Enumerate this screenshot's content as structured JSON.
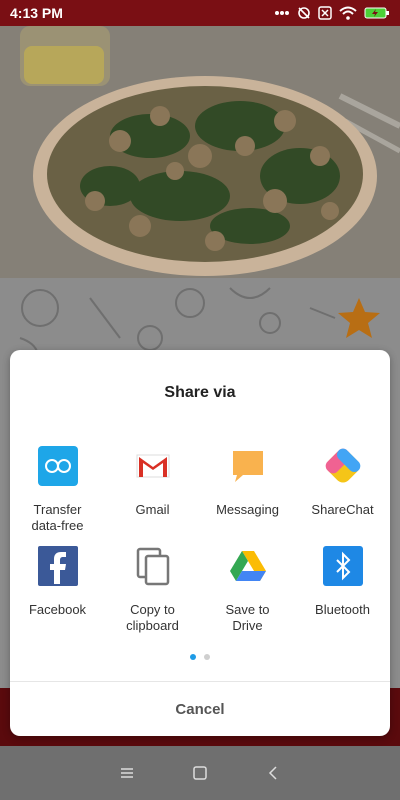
{
  "status": {
    "time": "4:13 PM"
  },
  "sheet": {
    "title": "Share via",
    "cancel": "Cancel",
    "apps": [
      {
        "label": "Transfer\ndata-free",
        "icon": "shareme-icon"
      },
      {
        "label": "Gmail",
        "icon": "gmail-icon"
      },
      {
        "label": "Messaging",
        "icon": "messaging-icon"
      },
      {
        "label": "ShareChat",
        "icon": "sharechat-icon"
      },
      {
        "label": "Facebook",
        "icon": "facebook-icon"
      },
      {
        "label": "Copy to\nclipboard",
        "icon": "copy-icon"
      },
      {
        "label": "Save to\nDrive",
        "icon": "drive-icon"
      },
      {
        "label": "Bluetooth",
        "icon": "bluetooth-icon"
      }
    ],
    "page_indicator": {
      "pages": 2,
      "current": 1
    }
  },
  "colors": {
    "statusbar": "#7a0f14",
    "accent": "#1e9be6",
    "star": "#b86e14"
  }
}
